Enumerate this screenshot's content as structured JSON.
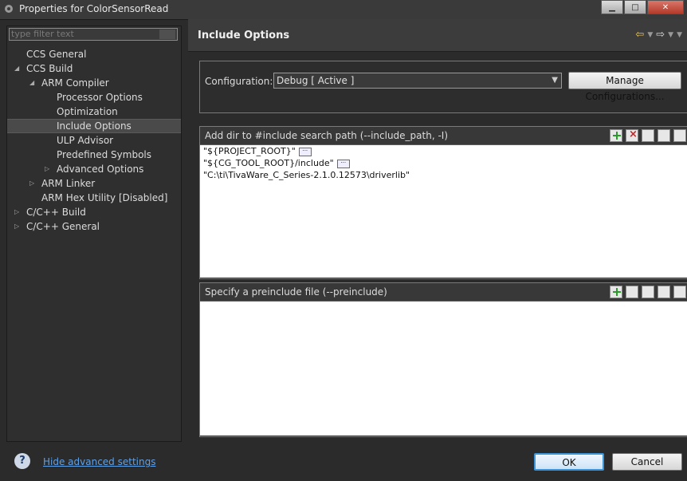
{
  "window": {
    "title": "Properties for ColorSensorRead"
  },
  "filter": {
    "placeholder": "type filter text"
  },
  "tree": [
    {
      "label": "CCS General",
      "indent": 0,
      "twisty": ""
    },
    {
      "label": "CCS Build",
      "indent": 0,
      "twisty": "expanded"
    },
    {
      "label": "ARM Compiler",
      "indent": 1,
      "twisty": "expanded"
    },
    {
      "label": "Processor Options",
      "indent": 2,
      "twisty": ""
    },
    {
      "label": "Optimization",
      "indent": 2,
      "twisty": ""
    },
    {
      "label": "Include Options",
      "indent": 2,
      "twisty": "",
      "selected": true
    },
    {
      "label": "ULP Advisor",
      "indent": 2,
      "twisty": ""
    },
    {
      "label": "Predefined Symbols",
      "indent": 2,
      "twisty": ""
    },
    {
      "label": "Advanced Options",
      "indent": 2,
      "twisty": "collapsed"
    },
    {
      "label": "ARM Linker",
      "indent": 1,
      "twisty": "collapsed"
    },
    {
      "label": "ARM Hex Utility  [Disabled]",
      "indent": 1,
      "twisty": ""
    },
    {
      "label": "C/C++ Build",
      "indent": 0,
      "twisty": "collapsed"
    },
    {
      "label": "C/C++ General",
      "indent": 0,
      "twisty": "collapsed"
    }
  ],
  "page": {
    "title": "Include Options"
  },
  "configuration": {
    "label": "Configuration:",
    "value": "Debug  [ Active ]",
    "manage_label": "Manage Configurations..."
  },
  "include_paths": {
    "title": "Add dir to #include search path (--include_path, -I)",
    "items": [
      "\"${PROJECT_ROOT}\"",
      "\"${CG_TOOL_ROOT}/include\"",
      "\"C:\\ti\\TivaWare_C_Series-2.1.0.12573\\driverlib\""
    ]
  },
  "preinclude": {
    "title": "Specify a preinclude file (--preinclude)"
  },
  "footer": {
    "help_symbol": "?",
    "advanced_link": "Hide advanced settings",
    "ok_label": "OK",
    "cancel_label": "Cancel"
  },
  "colors": {
    "accent": "#3c94d9",
    "link": "#5fa0e6",
    "nav_arrow": "#e9c25a"
  }
}
